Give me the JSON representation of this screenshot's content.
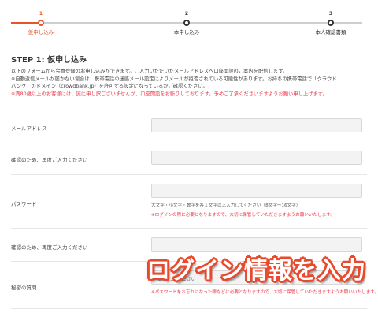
{
  "progress": {
    "steps": [
      {
        "number": "1",
        "label": "仮申し込み"
      },
      {
        "number": "2",
        "label": "本申し込み"
      },
      {
        "number": "3",
        "label": "本人確認書類"
      }
    ]
  },
  "page": {
    "heading": "STEP 1: 仮申し込み",
    "intro_line1": "以下のフォームから会員登録のお申し込みができます。ご入力いただいたメールアドレスへ口座開設のご案内を配信します。",
    "intro_line2": "※自動返信メールが届かない場合は、携帯電話の迷惑メール設定によりメールが拒否されている可能性があります。お持ちの携帯電話で「クラウド",
    "intro_line3": "バンク」のドメイン（crowdbank.jp）を許可する設定になっているかご確認ください。",
    "intro_warning": "※満80歳以上のお客様には、誠に申し訳ございませんが、口座開設をお断りしております。予めご了承くださいますようお願い申し上げます。"
  },
  "form": {
    "email_label": "メールアドレス",
    "email_confirm_label": "確認のため、再度ご入力ください",
    "password_label": "パスワード",
    "password_help": "大文字・小文字・数字を各１文字以上入力してください（8文字〜16文字）",
    "password_warning": "※ログインの際に必要となりますので、大切に保管していただきますようお願いいたします。",
    "password_confirm_label": "確認のため、再度ご入力ください",
    "secret_question_label": "秘密の質問",
    "secret_question_placeholder": "選択してください",
    "secret_question_warning": "※パスワードをお忘れになった際などに必要となりますので、大切に保管していただきますようお願いいたします。"
  },
  "overlay_caption": "ログイン情報を入力",
  "colors": {
    "accent": "#e8542a",
    "warning": "#ee3344"
  }
}
